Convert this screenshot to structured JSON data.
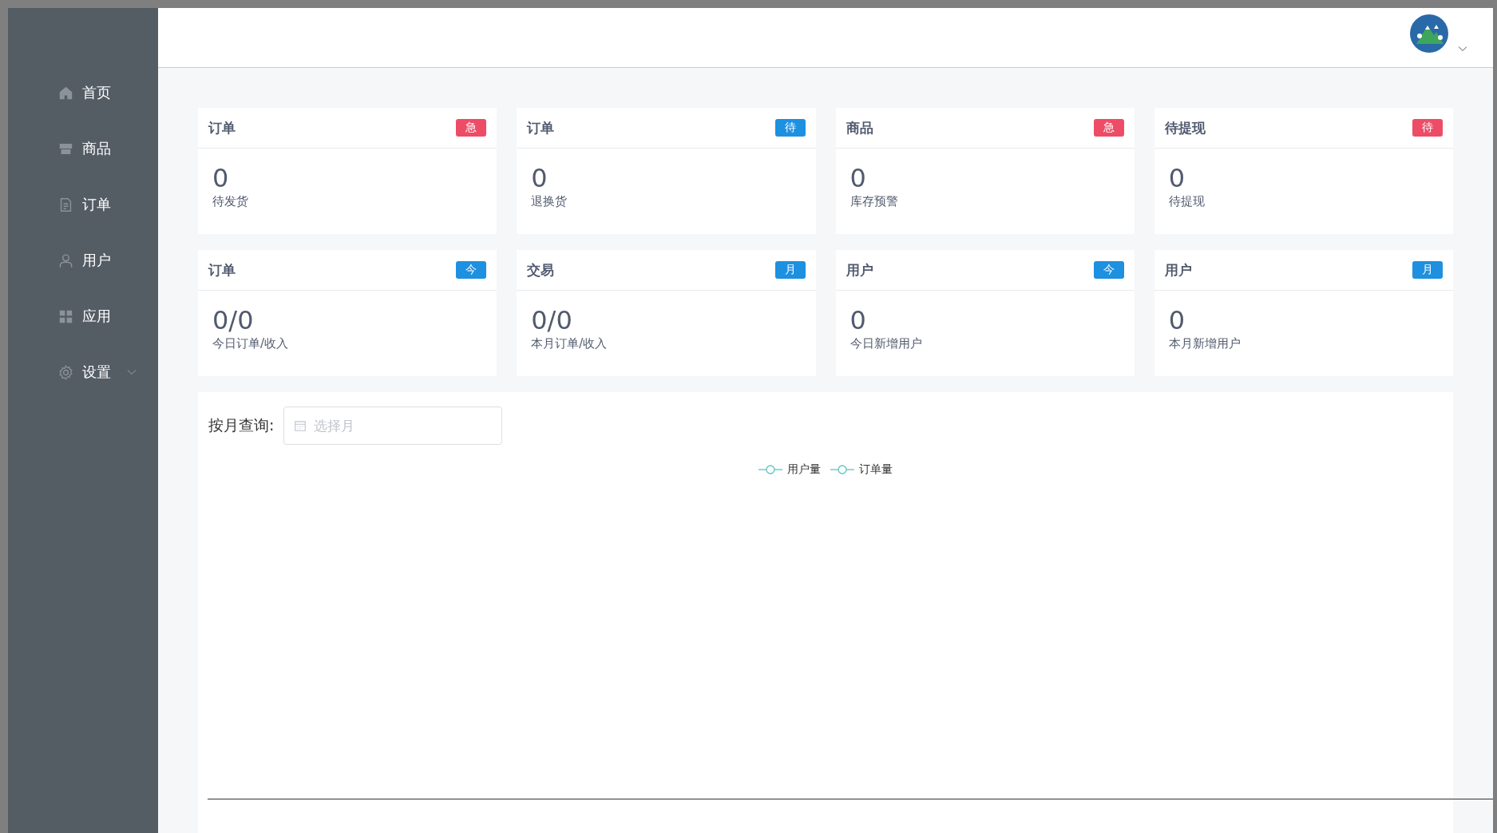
{
  "sidebar": {
    "items": [
      {
        "label": "首页",
        "kind": "link"
      },
      {
        "label": "商品",
        "kind": "link"
      },
      {
        "label": "订单",
        "kind": "link"
      },
      {
        "label": "用户",
        "kind": "link"
      },
      {
        "label": "应用",
        "kind": "link"
      },
      {
        "label": "设置",
        "kind": "submenu"
      }
    ]
  },
  "stat_cards": [
    {
      "title": "订单",
      "badge": "急",
      "color": "#ed4c67",
      "value": "0",
      "caption": "待发货"
    },
    {
      "title": "订单",
      "badge": "待",
      "color": "#1e90e0",
      "value": "0",
      "caption": "退换货"
    },
    {
      "title": "商品",
      "badge": "急",
      "color": "#ed4c67",
      "value": "0",
      "caption": "库存预警"
    },
    {
      "title": "待提现",
      "badge": "待",
      "color": "#ed4c67",
      "value": "0",
      "caption": "待提现"
    },
    {
      "title": "订单",
      "badge": "今",
      "color": "#1e90e0",
      "value": "0/0",
      "caption": "今日订单/收入"
    },
    {
      "title": "交易",
      "badge": "月",
      "color": "#1e90e0",
      "value": "0/0",
      "caption": "本月订单/收入"
    },
    {
      "title": "用户",
      "badge": "今",
      "color": "#1e90e0",
      "value": "0",
      "caption": "今日新增用户"
    },
    {
      "title": "用户",
      "badge": "月",
      "color": "#1e90e0",
      "value": "0",
      "caption": "本月新增用户"
    }
  ],
  "chart_panel": {
    "filter_label": "按月查询:",
    "month_picker": {
      "placeholder": "选择月"
    },
    "legend": [
      "用户量",
      "订单量"
    ]
  }
}
